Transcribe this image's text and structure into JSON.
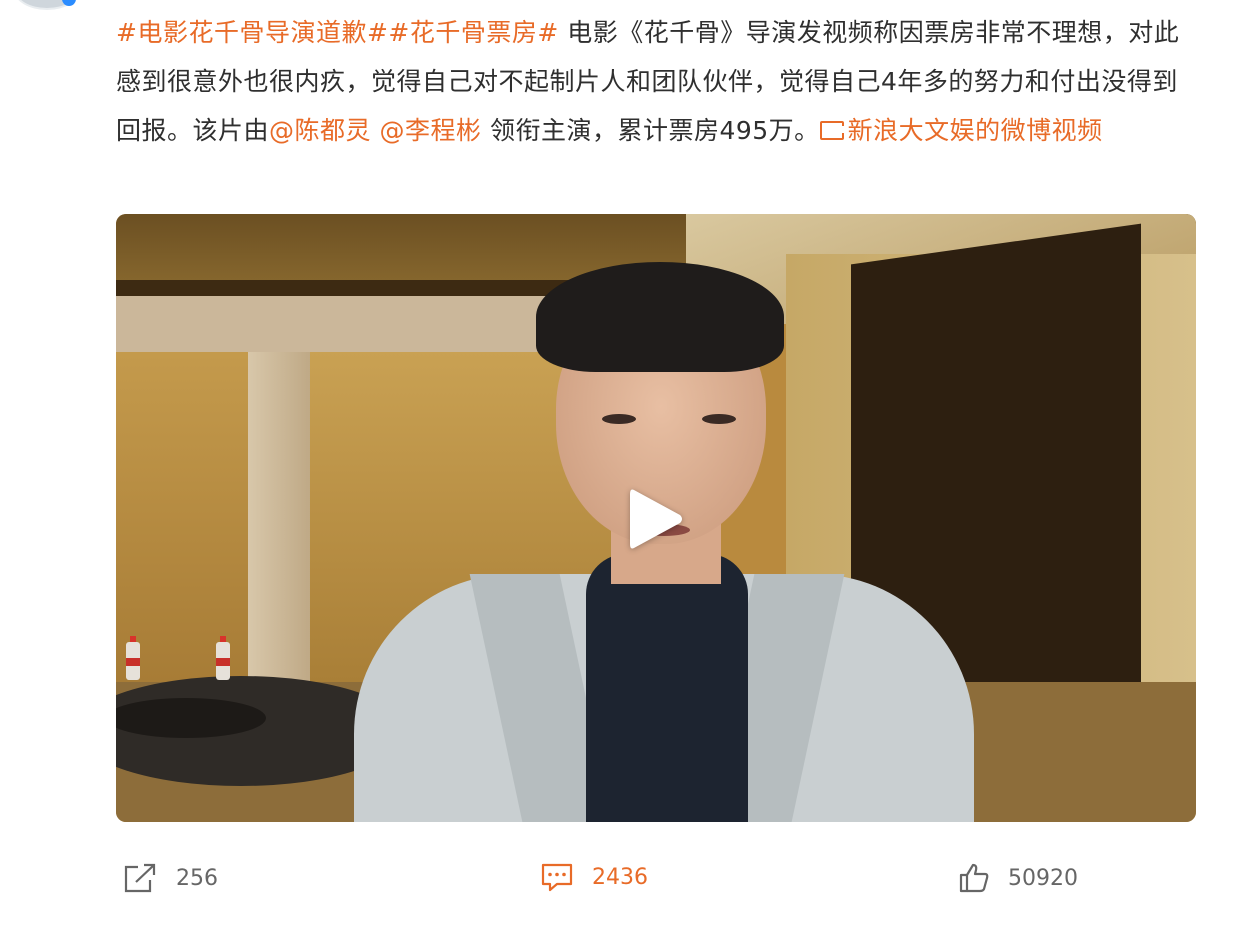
{
  "post": {
    "hashtag1": "#电影花千骨导演道歉#",
    "hashtag2": "#花千骨票房#",
    "text_part1": " 电影《花千骨》导演发视频称因票房非常不理想，对此感到很意外也很内疚，觉得自己对不起制片人和团队伙伴，觉得自己4年多的努力和付出没得到回报。该片由",
    "mention1": "@陈都灵",
    "mention2": "@李程彬",
    "text_part2": " 领衔主演，累计票房495万。",
    "video_link": "新浪大文娱的微博视频"
  },
  "video": {
    "play_icon": "play-icon"
  },
  "actions": {
    "share": {
      "icon": "share-icon",
      "count": "256"
    },
    "comment": {
      "icon": "comment-icon",
      "count": "2436"
    },
    "like": {
      "icon": "thumbs-up-icon",
      "count": "50920"
    }
  },
  "colors": {
    "accent": "#e86b28",
    "text": "#2f2f2f",
    "muted": "#666666"
  }
}
